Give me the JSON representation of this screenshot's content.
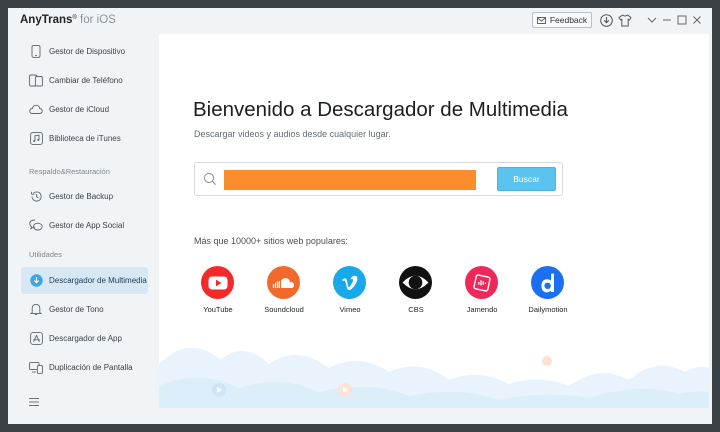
{
  "titlebar": {
    "brand": "AnyTrans",
    "registered": "®",
    "subtitle": "for iOS",
    "feedback_label": "Feedback"
  },
  "sidebar": {
    "items": [
      {
        "label": "Gestor de Dispositivo",
        "icon": "phone-icon"
      },
      {
        "label": "Cambiar de Teléfono",
        "icon": "phone-switch-icon"
      },
      {
        "label": "Gestor de iCloud",
        "icon": "cloud-icon"
      },
      {
        "label": "Biblioteca de iTunes",
        "icon": "music-library-icon"
      },
      {
        "label": "Gestor de Backup",
        "icon": "backup-history-icon"
      },
      {
        "label": "Gestor de App Social",
        "icon": "chat-bubbles-icon"
      },
      {
        "label": "Descargador de Multimedia",
        "icon": "download-circle-icon"
      },
      {
        "label": "Gestor de Tono",
        "icon": "bell-icon"
      },
      {
        "label": "Descargador de App",
        "icon": "app-store-icon"
      },
      {
        "label": "Duplicación de Pantalla",
        "icon": "screen-mirror-icon"
      }
    ],
    "sections": [
      "Respaldo&Restauración",
      "Utilidades"
    ],
    "active_index": 6
  },
  "main": {
    "title": "Bienvenido a Descargador de Multimedia",
    "subtitle": "Descargar videos y audios desde cualquier lugar.",
    "search": {
      "value": "",
      "button_label": "Buscar"
    },
    "popular_label": "Más que 10000+ sitios web populares:",
    "sites": [
      {
        "name": "YouTube",
        "color": "#f42a2a"
      },
      {
        "name": "Soundcloud",
        "color": "#f26a2b"
      },
      {
        "name": "Vimeo",
        "color": "#18a9ea"
      },
      {
        "name": "CBS",
        "color": "#111111"
      },
      {
        "name": "Jamendo",
        "color": "#f0285a"
      },
      {
        "name": "Dailymotion",
        "color": "#1a6ff2"
      }
    ]
  },
  "colors": {
    "accent": "#5bc3f0",
    "active_nav": "#d7e7f4",
    "search_highlight": "#fb8d2c"
  }
}
